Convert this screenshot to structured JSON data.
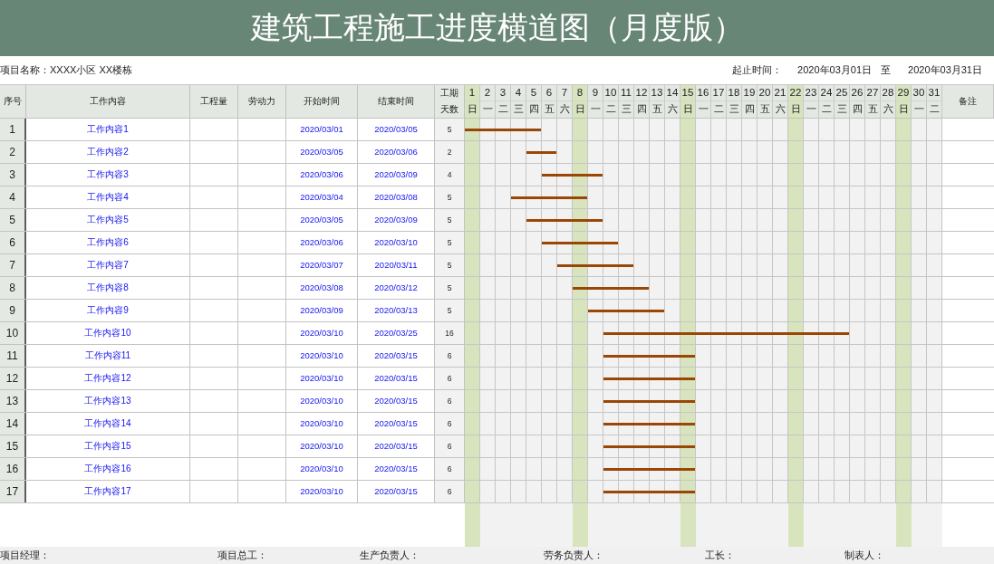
{
  "title": "建筑工程施工进度横道图（月度版）",
  "info": {
    "project": "项目名称：XXXX小区 XX楼栋",
    "period_label": "起止时间：",
    "period_start": "2020年03月01日",
    "period_separator": "至",
    "period_end": "2020年03月31日"
  },
  "table": {
    "columns": [
      "序号",
      "工作内容",
      "工程量",
      "劳动力",
      "开始时间",
      "结束时间",
      "工期天数"
    ],
    "days": [
      {
        "number": "1",
        "weekday": "日",
        "rest_day": true
      },
      {
        "number": "2",
        "weekday": "一",
        "rest_day": false
      },
      {
        "number": "3",
        "weekday": "二",
        "rest_day": false
      },
      {
        "number": "4",
        "weekday": "三",
        "rest_day": false
      },
      {
        "number": "5",
        "weekday": "四",
        "rest_day": false
      },
      {
        "number": "6",
        "weekday": "五",
        "rest_day": false
      },
      {
        "number": "7",
        "weekday": "六",
        "rest_day": false
      },
      {
        "number": "8",
        "weekday": "日",
        "rest_day": true
      },
      {
        "number": "9",
        "weekday": "一",
        "rest_day": false
      },
      {
        "number": "10",
        "weekday": "二",
        "rest_day": false
      },
      {
        "number": "11",
        "weekday": "三",
        "rest_day": false
      },
      {
        "number": "12",
        "weekday": "四",
        "rest_day": false
      },
      {
        "number": "13",
        "weekday": "五",
        "rest_day": false
      },
      {
        "number": "14",
        "weekday": "六",
        "rest_day": false
      },
      {
        "number": "15",
        "weekday": "日",
        "rest_day": true
      },
      {
        "number": "16",
        "weekday": "一",
        "rest_day": false
      },
      {
        "number": "17",
        "weekday": "二",
        "rest_day": false
      },
      {
        "number": "18",
        "weekday": "三",
        "rest_day": false
      },
      {
        "number": "19",
        "weekday": "四",
        "rest_day": false
      },
      {
        "number": "20",
        "weekday": "五",
        "rest_day": false
      },
      {
        "number": "21",
        "weekday": "六",
        "rest_day": false
      },
      {
        "number": "22",
        "weekday": "日",
        "rest_day": true
      },
      {
        "number": "23",
        "weekday": "一",
        "rest_day": false
      },
      {
        "number": "24",
        "weekday": "二",
        "rest_day": false
      },
      {
        "number": "25",
        "weekday": "三",
        "rest_day": false
      },
      {
        "number": "26",
        "weekday": "四",
        "rest_day": false
      },
      {
        "number": "27",
        "weekday": "五",
        "rest_day": false
      },
      {
        "number": "28",
        "weekday": "六",
        "rest_day": false
      },
      {
        "number": "29",
        "weekday": "日",
        "rest_day": true
      },
      {
        "number": "30",
        "weekday": "一",
        "rest_day": false
      },
      {
        "number": "31",
        "weekday": "二",
        "rest_day": false
      }
    ],
    "remarks_column": "备注",
    "rows": [
      {
        "no": "1",
        "task": "工作内容1",
        "start": "2020/03/01",
        "end": "2020/03/05",
        "duration": "5"
      },
      {
        "no": "2",
        "task": "工作内容2",
        "start": "2020/03/05",
        "end": "2020/03/06",
        "duration": "2"
      },
      {
        "no": "3",
        "task": "工作内容3",
        "start": "2020/03/06",
        "end": "2020/03/09",
        "duration": "4"
      },
      {
        "no": "4",
        "task": "工作内容4",
        "start": "2020/03/04",
        "end": "2020/03/08",
        "duration": "5"
      },
      {
        "no": "5",
        "task": "工作内容5",
        "start": "2020/03/05",
        "end": "2020/03/09",
        "duration": "5"
      },
      {
        "no": "6",
        "task": "工作内容6",
        "start": "2020/03/06",
        "end": "2020/03/10",
        "duration": "5"
      },
      {
        "no": "7",
        "task": "工作内容7",
        "start": "2020/03/07",
        "end": "2020/03/11",
        "duration": "5"
      },
      {
        "no": "8",
        "task": "工作内容8",
        "start": "2020/03/08",
        "end": "2020/03/12",
        "duration": "5"
      },
      {
        "no": "9",
        "task": "工作内容9",
        "start": "2020/03/09",
        "end": "2020/03/13",
        "duration": "5"
      },
      {
        "no": "10",
        "task": "工作内容10",
        "start": "2020/03/10",
        "end": "2020/03/25",
        "duration": "16"
      },
      {
        "no": "11",
        "task": "工作内容11",
        "start": "2020/03/10",
        "end": "2020/03/15",
        "duration": "6"
      },
      {
        "no": "12",
        "task": "工作内容12",
        "start": "2020/03/10",
        "end": "2020/03/15",
        "duration": "6"
      },
      {
        "no": "13",
        "task": "工作内容13",
        "start": "2020/03/10",
        "end": "2020/03/15",
        "duration": "6"
      },
      {
        "no": "14",
        "task": "工作内容14",
        "start": "2020/03/10",
        "end": "2020/03/15",
        "duration": "6"
      },
      {
        "no": "15",
        "task": "工作内容15",
        "start": "2020/03/10",
        "end": "2020/03/15",
        "duration": "6"
      },
      {
        "no": "16",
        "task": "工作内容16",
        "start": "2020/03/10",
        "end": "2020/03/15",
        "duration": "6"
      },
      {
        "no": "17",
        "task": "工作内容17",
        "start": "2020/03/10",
        "end": "2020/03/15",
        "duration": "6"
      }
    ]
  },
  "footer": [
    "项目经理：",
    "项目总工：",
    "生产负责人：",
    "劳务负责人：",
    "工长：",
    "制表人："
  ]
}
